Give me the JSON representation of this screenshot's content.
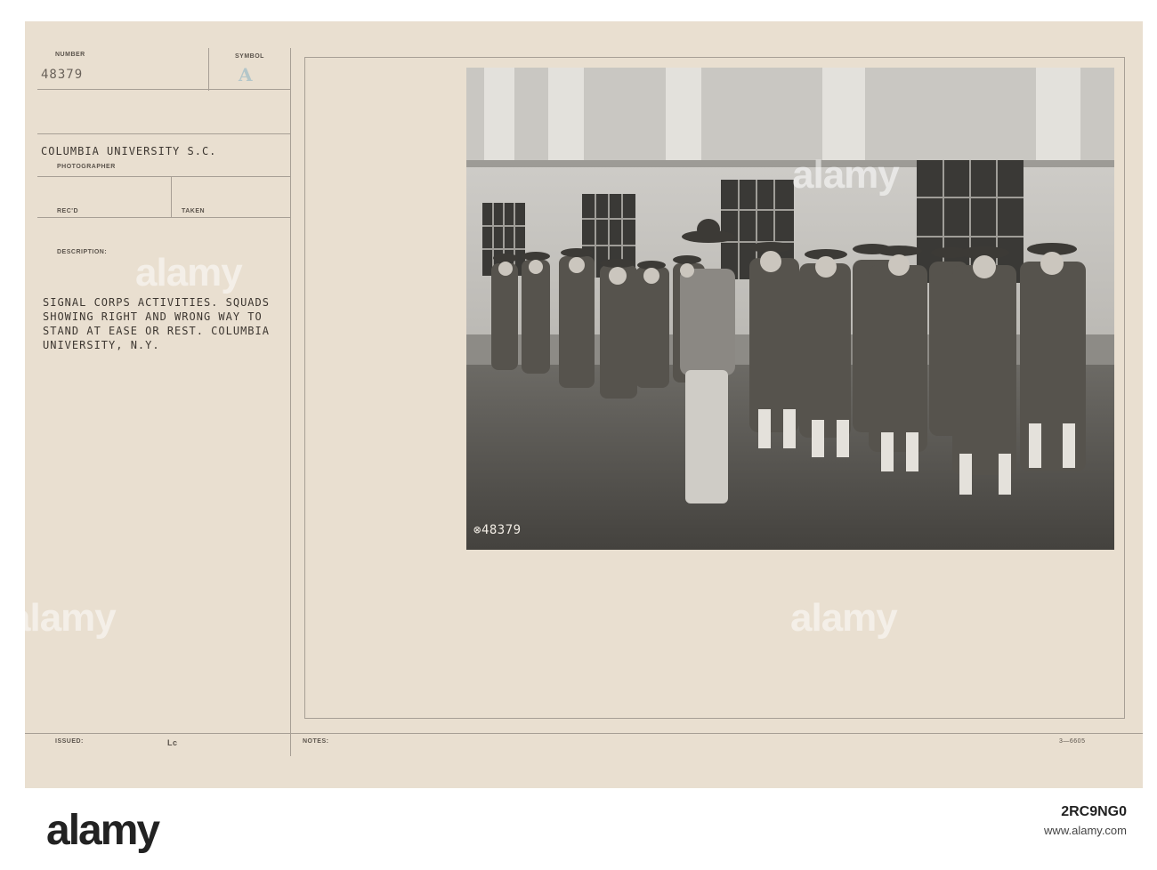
{
  "record": {
    "number_label": "NUMBER",
    "number_value": "48379",
    "symbol_label": "SYMBOL",
    "symbol_value": "A",
    "source": "COLUMBIA UNIVERSITY S.C.",
    "photographer_label": "PHOTOGRAPHER",
    "recd_label": "REC'D",
    "taken_label": "TAKEN",
    "description_label": "DESCRIPTION:",
    "description_lines": [
      "SIGNAL CORPS ACTIVITIES. SQUADS",
      "SHOWING RIGHT AND WRONG WAY TO",
      "STAND AT EASE OR REST. COLUMBIA",
      "UNIVERSITY, N.Y."
    ],
    "issued_label": "ISSUED:",
    "issued_mark": "Lc",
    "notes_label": "NOTES:",
    "form_number": "3—6605"
  },
  "photo": {
    "negative_number": "48379"
  },
  "watermark": {
    "text": "alamy"
  },
  "footer": {
    "brand": "alamy",
    "image_id": "2RC9NG0",
    "site": "www.alamy.com"
  },
  "colors": {
    "card": "#e9dfd0",
    "rule": "#a79f95",
    "photo_dark": "#4e4c48",
    "symbol_teal": "#b3c6c9"
  }
}
